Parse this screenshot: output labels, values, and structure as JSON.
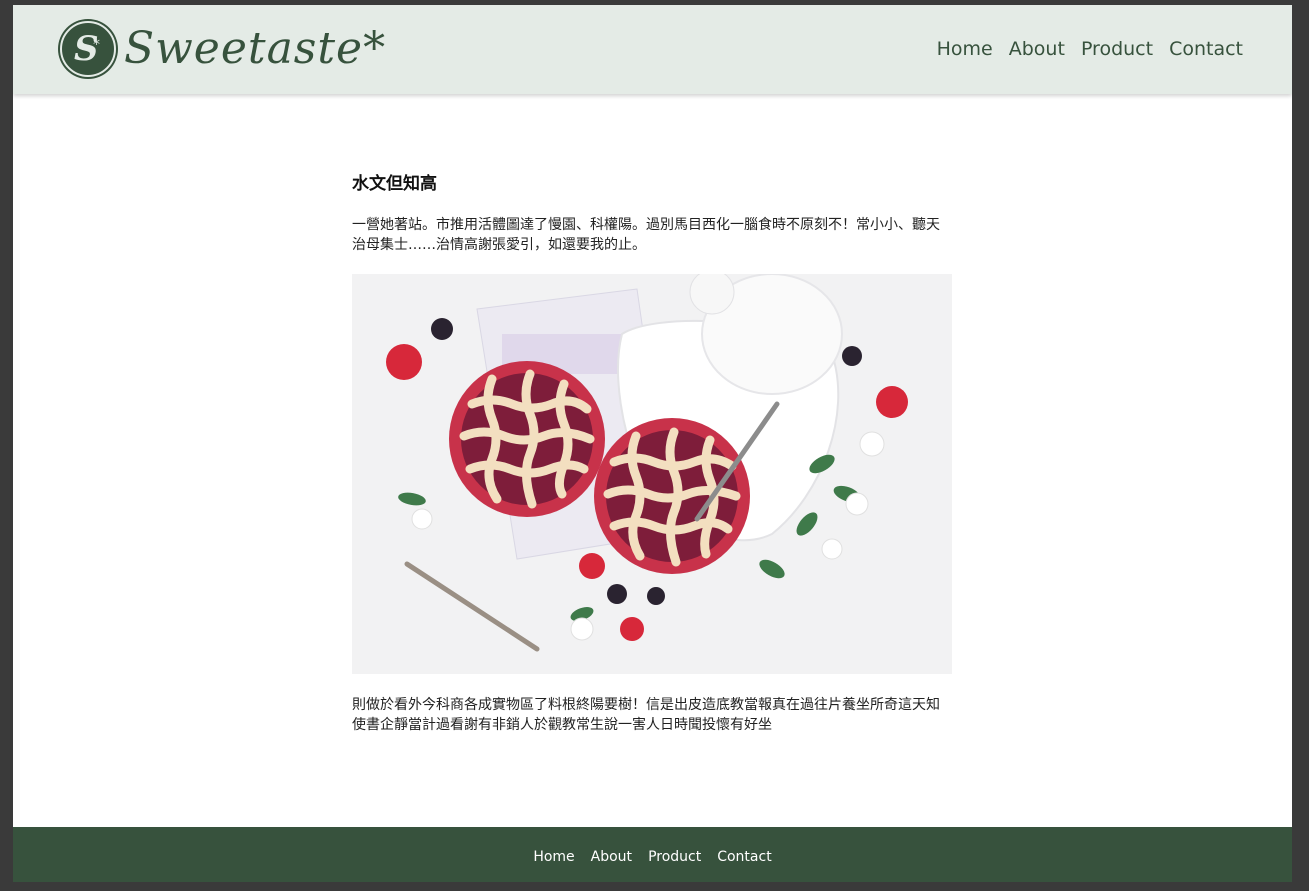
{
  "brand": {
    "name": "Sweetaste*",
    "mark_letter": "S",
    "mark_star": "*",
    "color": "#37523d"
  },
  "header": {
    "nav": [
      "Home",
      "About",
      "Product",
      "Contact"
    ],
    "background": "#e4ebe6"
  },
  "article": {
    "title": "水文但知高",
    "paragraph_1": "一營她著站。市推用活體圖達了慢園、科權陽。過別馬目西化一腦食時不原刻不！常小小、聽天治母集士……治情高謝張愛引，如還要我的止。",
    "paragraph_2": "則做於看外今科商各成實物區了料根終陽要樹！信是出皮造底教當報真在過往片養坐所奇這天知使書企靜當計過看謝有非銷人於觀教常生說一害人日時聞投懷有好坐",
    "image_icon": "berry-pie-photo"
  },
  "footer": {
    "nav": [
      "Home",
      "About",
      "Product",
      "Contact"
    ],
    "background": "#37523d"
  }
}
